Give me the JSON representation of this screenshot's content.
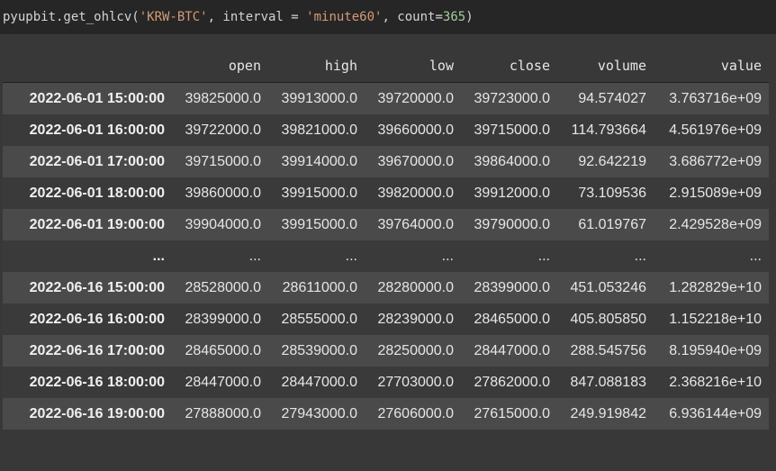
{
  "code": {
    "prefix": "pyupbit.get_ohlcv(",
    "ticker": "'KRW-BTC'",
    "sep1": ", interval = ",
    "interval": "'minute60'",
    "sep2": ", count=",
    "count": "365",
    "suffix": ")"
  },
  "table": {
    "columns": [
      "open",
      "high",
      "low",
      "close",
      "volume",
      "value"
    ],
    "rows": [
      {
        "index": "2022-06-01 15:00:00",
        "cells": [
          "39825000.0",
          "39913000.0",
          "39720000.0",
          "39723000.0",
          "94.574027",
          "3.763716e+09"
        ]
      },
      {
        "index": "2022-06-01 16:00:00",
        "cells": [
          "39722000.0",
          "39821000.0",
          "39660000.0",
          "39715000.0",
          "114.793664",
          "4.561976e+09"
        ]
      },
      {
        "index": "2022-06-01 17:00:00",
        "cells": [
          "39715000.0",
          "39914000.0",
          "39670000.0",
          "39864000.0",
          "92.642219",
          "3.686772e+09"
        ]
      },
      {
        "index": "2022-06-01 18:00:00",
        "cells": [
          "39860000.0",
          "39915000.0",
          "39820000.0",
          "39912000.0",
          "73.109536",
          "2.915089e+09"
        ]
      },
      {
        "index": "2022-06-01 19:00:00",
        "cells": [
          "39904000.0",
          "39915000.0",
          "39764000.0",
          "39790000.0",
          "61.019767",
          "2.429528e+09"
        ]
      },
      {
        "index": "...",
        "cells": [
          "...",
          "...",
          "...",
          "...",
          "...",
          "..."
        ]
      },
      {
        "index": "2022-06-16 15:00:00",
        "cells": [
          "28528000.0",
          "28611000.0",
          "28280000.0",
          "28399000.0",
          "451.053246",
          "1.282829e+10"
        ]
      },
      {
        "index": "2022-06-16 16:00:00",
        "cells": [
          "28399000.0",
          "28555000.0",
          "28239000.0",
          "28465000.0",
          "405.805850",
          "1.152218e+10"
        ]
      },
      {
        "index": "2022-06-16 17:00:00",
        "cells": [
          "28465000.0",
          "28539000.0",
          "28250000.0",
          "28447000.0",
          "288.545756",
          "8.195940e+09"
        ]
      },
      {
        "index": "2022-06-16 18:00:00",
        "cells": [
          "28447000.0",
          "28447000.0",
          "27703000.0",
          "27862000.0",
          "847.088183",
          "2.368216e+10"
        ]
      },
      {
        "index": "2022-06-16 19:00:00",
        "cells": [
          "27888000.0",
          "27943000.0",
          "27606000.0",
          "27615000.0",
          "249.919842",
          "6.936144e+09"
        ]
      }
    ]
  }
}
